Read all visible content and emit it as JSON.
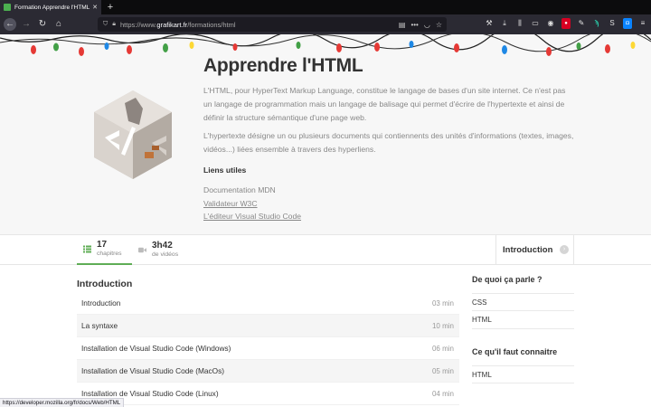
{
  "browser": {
    "tab_title": "Formation Apprendre l'HTML | Gr",
    "tab_close_icon": "close-icon",
    "new_tab_label": "+",
    "url_prefix": "https://www.",
    "url_domain": "grafikart.fr",
    "url_path": "/formations/html",
    "url_more": "•••",
    "status_url": "https://developer.mozilla.org/fr/docs/Web/HTML"
  },
  "hero": {
    "title": "Apprendre l'HTML",
    "paragraph1": "L'HTML, pour HyperText Markup Language, constitue le langage de bases d'un site internet. Ce n'est pas un langage de programmation mais un langage de balisage qui permet d'écrire de l'hypertexte et ainsi de définir la structure sémantique d'une page web.",
    "paragraph2": "L'hypertexte désigne un ou plusieurs documents qui contiennents des unités d'informations (textes, images, vidéos...) liées ensemble à travers des hyperliens.",
    "links_heading": "Liens utiles",
    "links": [
      "Documentation MDN",
      "Validateur W3C",
      "L'éditeur Visual Studio Code"
    ]
  },
  "stats": {
    "chapters_count": "17",
    "chapters_label": "chapitres",
    "duration": "3h42",
    "duration_label": "de vidéos",
    "next_label": "Introduction"
  },
  "main": {
    "heading": "Introduction",
    "chapters": [
      {
        "title": "Introduction",
        "duration": "03 min"
      },
      {
        "title": "La syntaxe",
        "duration": "10 min"
      },
      {
        "title": "Installation de Visual Studio Code (Windows)",
        "duration": "06 min"
      },
      {
        "title": "Installation de Visual Studio Code (MacOs)",
        "duration": "05 min"
      },
      {
        "title": "Installation de Visual Studio Code (Linux)",
        "duration": "04 min"
      }
    ]
  },
  "sidebar": {
    "topics_heading": "De quoi ça parle ?",
    "topics": [
      "CSS",
      "HTML"
    ],
    "prereq_heading": "Ce qu'il faut connaitre",
    "prereqs": [
      "HTML"
    ]
  },
  "colors": {
    "accent_green": "#5fad56",
    "chrome_dark": "#2b2a33"
  }
}
